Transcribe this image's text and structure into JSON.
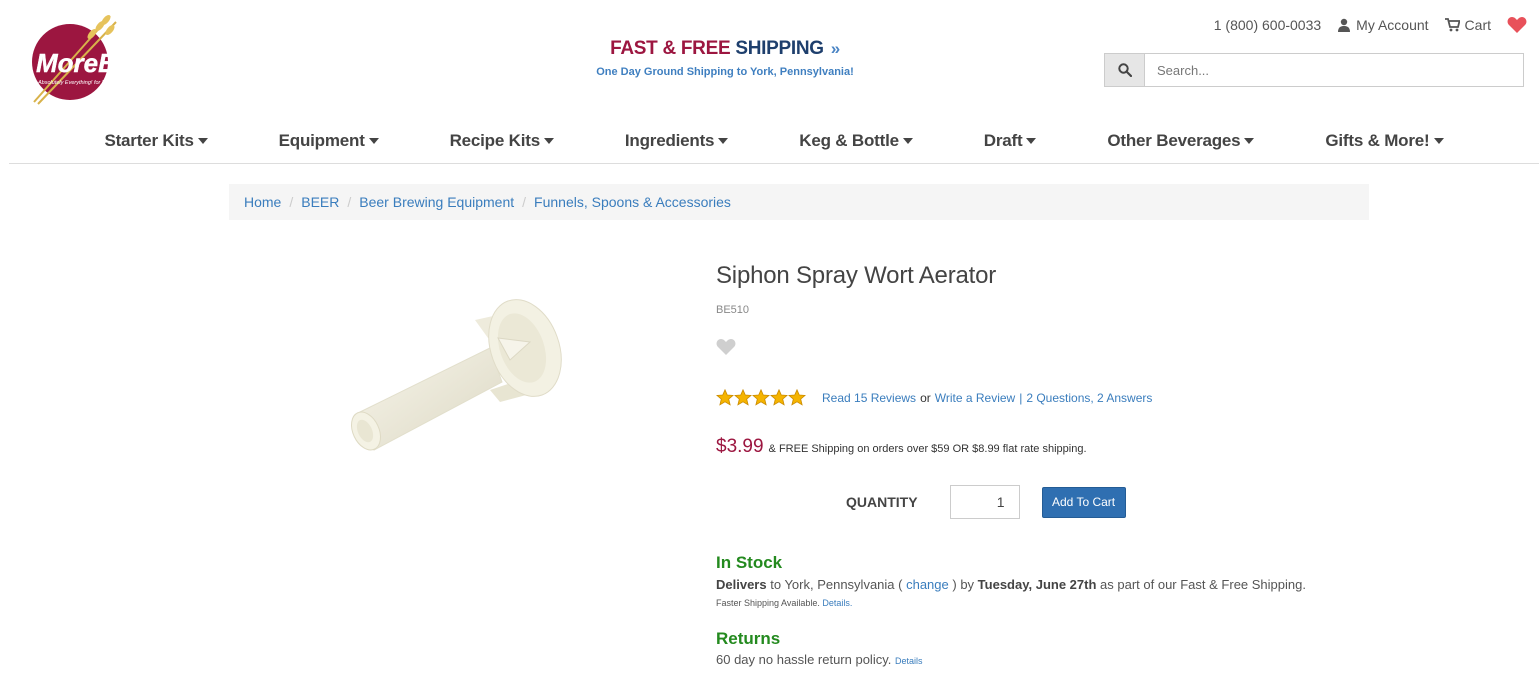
{
  "logo": {
    "brand": "MoreBeer!",
    "tagline": "Absolutely Everything! for Beer-Making"
  },
  "banner": {
    "title_a": "FAST & FREE",
    "title_b": "SHIPPING",
    "arrows": "»",
    "subtitle": "One Day Ground Shipping to York, Pennsylvania!"
  },
  "top_links": {
    "phone": "1 (800) 600-0033",
    "account": "My Account",
    "cart": "Cart"
  },
  "search": {
    "placeholder": "Search..."
  },
  "nav": {
    "items": [
      {
        "label": "Starter Kits"
      },
      {
        "label": "Equipment"
      },
      {
        "label": "Recipe Kits"
      },
      {
        "label": "Ingredients"
      },
      {
        "label": "Keg & Bottle"
      },
      {
        "label": "Draft"
      },
      {
        "label": "Other Beverages"
      },
      {
        "label": "Gifts & More!"
      }
    ]
  },
  "breadcrumb": [
    {
      "label": "Home"
    },
    {
      "label": "BEER"
    },
    {
      "label": "Beer Brewing Equipment"
    },
    {
      "label": "Funnels, Spoons & Accessories"
    }
  ],
  "product": {
    "title": "Siphon Spray Wort Aerator",
    "sku": "BE510",
    "rating": 5,
    "reviews_link": "Read 15 Reviews",
    "or_text": "or",
    "write_review": "Write a Review",
    "bar": "|",
    "qa_link": "2 Questions, 2 Answers",
    "price": "$3.99",
    "price_note": "& FREE Shipping on orders over $59 OR $8.99 flat rate shipping.",
    "quantity_label": "QUANTITY",
    "quantity_value": "1",
    "add_to_cart": "Add To Cart"
  },
  "stock": {
    "heading": "In Stock",
    "delivers_bold": "Delivers",
    "delivers_text1": "to York, Pennsylvania (",
    "change_link": "change",
    "delivers_text2": ") by",
    "delivery_date": "Tuesday, June 27th",
    "delivers_text3": "as part of our Fast & Free Shipping.",
    "faster_text": "Faster Shipping Available.",
    "details_link": "Details."
  },
  "returns": {
    "heading": "Returns",
    "text": "60 day no hassle return policy.",
    "details_link": "Details"
  },
  "colors": {
    "brand_red": "#9c1640",
    "brand_navy": "#1e3f6d",
    "link_blue": "#3a7dbd",
    "stock_green": "#248a1f",
    "button_blue": "#2f6fb1",
    "heart_red": "#e8515a"
  }
}
